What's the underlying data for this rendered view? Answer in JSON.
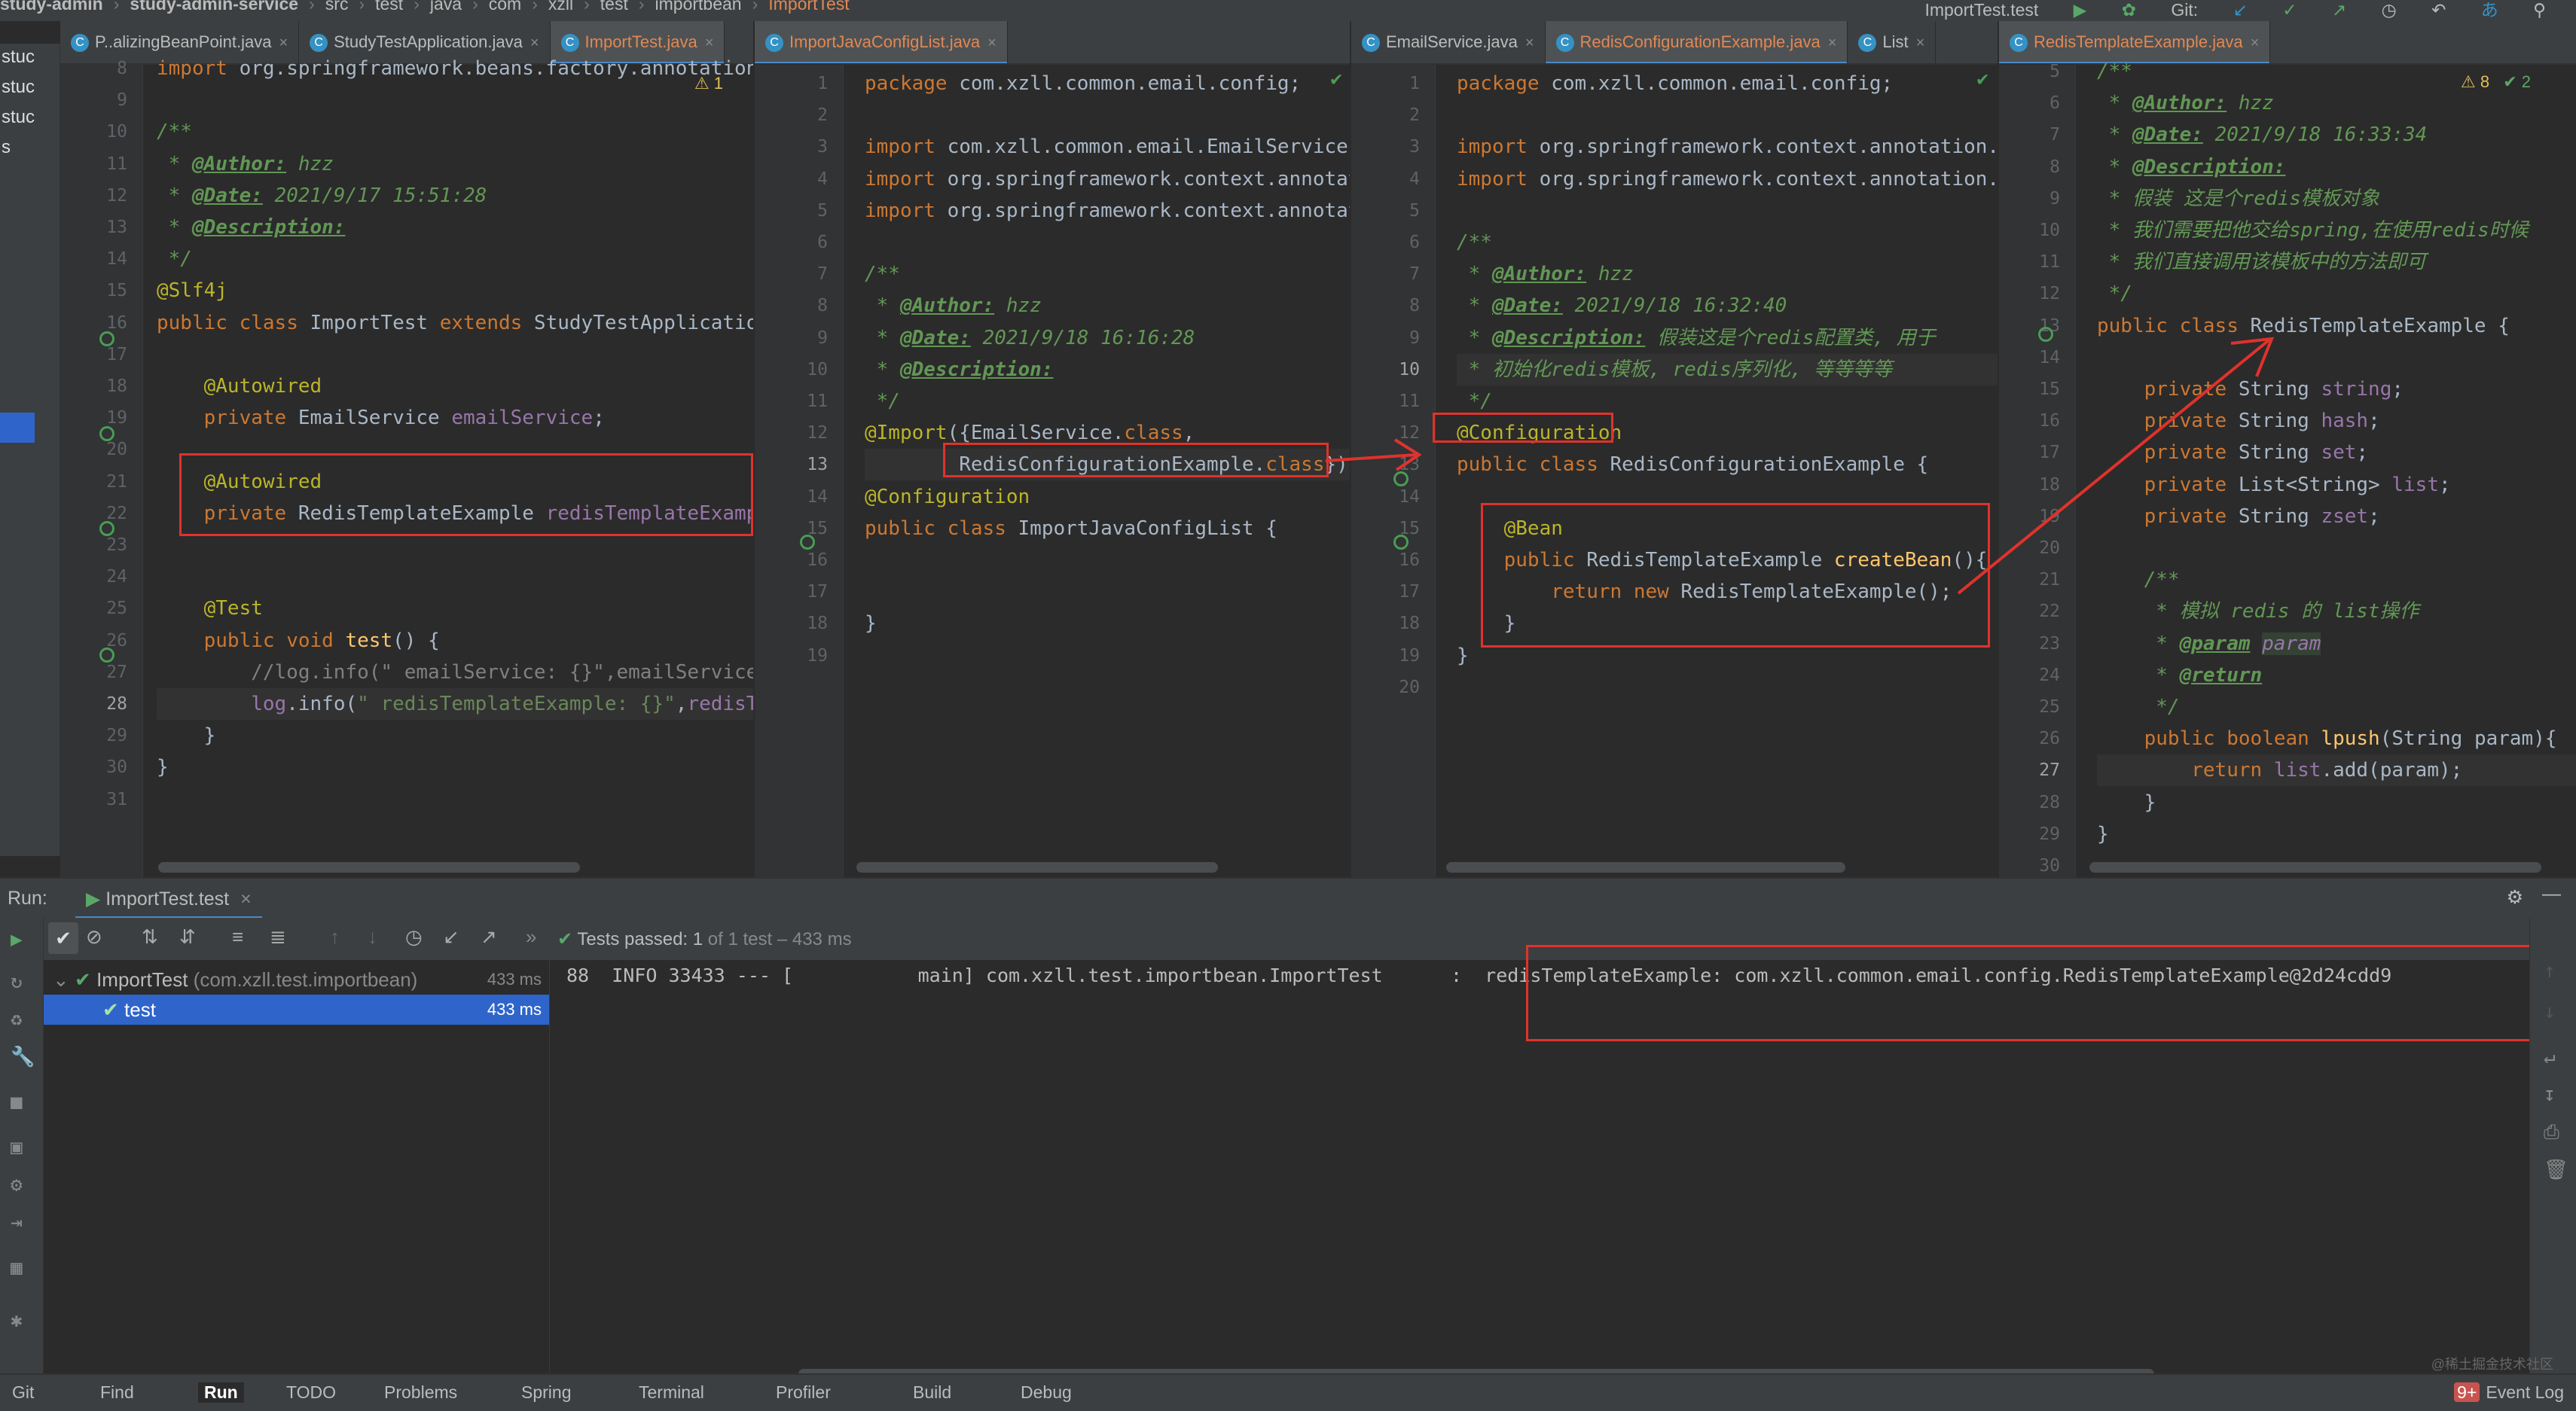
{
  "breadcrumb": [
    "study-admin",
    "study-admin-service",
    "src",
    "test",
    "java",
    "com",
    "xzll",
    "test",
    "importbean",
    "ImportTest"
  ],
  "topbar": {
    "run_config": "ImportTest.test",
    "git_label": "Git:"
  },
  "project_strip": [
    "stuc",
    "stuc",
    "stuc",
    "s"
  ],
  "pane1": {
    "tabs": [
      "P..alizingBeanPoint.java",
      "StudyTestApplication.java",
      "ImportTest.java"
    ],
    "warnings": "⚠ 1",
    "lines": [
      {
        "n": "8",
        "t": "import org.springframework.beans.factory.annotation.Autowired;"
      },
      {
        "n": "9",
        "t": ""
      },
      {
        "n": "10",
        "t": "/**"
      },
      {
        "n": "11",
        "t": " * @Author: hzz"
      },
      {
        "n": "12",
        "t": " * @Date: 2021/9/17 15:51:28"
      },
      {
        "n": "13",
        "t": " * @Description:"
      },
      {
        "n": "14",
        "t": " */"
      },
      {
        "n": "15",
        "t": "@Slf4j"
      },
      {
        "n": "16",
        "t": "public class ImportTest extends StudyTestApplication {"
      },
      {
        "n": "17",
        "t": ""
      },
      {
        "n": "18",
        "t": "    @Autowired"
      },
      {
        "n": "19",
        "t": "    private EmailService emailService;"
      },
      {
        "n": "20",
        "t": ""
      },
      {
        "n": "21",
        "t": "    @Autowired"
      },
      {
        "n": "22",
        "t": "    private RedisTemplateExample redisTemplateExample;"
      },
      {
        "n": "23",
        "t": ""
      },
      {
        "n": "24",
        "t": ""
      },
      {
        "n": "25",
        "t": "    @Test"
      },
      {
        "n": "26",
        "t": "    public void test() {"
      },
      {
        "n": "27",
        "t": "        //log.info(\" emailService: {}\",emailService);"
      },
      {
        "n": "28",
        "t": "        log.info(\" redisTemplateExample: {}\",redisTemplateExample);"
      },
      {
        "n": "29",
        "t": "    }"
      },
      {
        "n": "30",
        "t": "}"
      },
      {
        "n": "31",
        "t": ""
      }
    ]
  },
  "pane2": {
    "tabs": [
      "ImportJavaConfigList.java"
    ],
    "lines": [
      {
        "n": "1",
        "t": "package com.xzll.common.email.config;"
      },
      {
        "n": "2",
        "t": ""
      },
      {
        "n": "3",
        "t": "import com.xzll.common.email.EmailService;"
      },
      {
        "n": "4",
        "t": "import org.springframework.context.annotation.Configuration;"
      },
      {
        "n": "5",
        "t": "import org.springframework.context.annotation.Import;"
      },
      {
        "n": "6",
        "t": ""
      },
      {
        "n": "7",
        "t": "/**"
      },
      {
        "n": "8",
        "t": " * @Author: hzz"
      },
      {
        "n": "9",
        "t": " * @Date: 2021/9/18 16:16:28"
      },
      {
        "n": "10",
        "t": " * @Description:"
      },
      {
        "n": "11",
        "t": " */"
      },
      {
        "n": "12",
        "t": "@Import({EmailService.class,"
      },
      {
        "n": "13",
        "t": "        RedisConfigurationExample.class})"
      },
      {
        "n": "14",
        "t": "@Configuration"
      },
      {
        "n": "15",
        "t": "public class ImportJavaConfigList {"
      },
      {
        "n": "16",
        "t": ""
      },
      {
        "n": "17",
        "t": ""
      },
      {
        "n": "18",
        "t": "}"
      },
      {
        "n": "19",
        "t": ""
      }
    ]
  },
  "pane3": {
    "tabs": [
      "EmailService.java",
      "RedisConfigurationExample.java",
      "List"
    ],
    "lines": [
      {
        "n": "1",
        "t": "package com.xzll.common.email.config;"
      },
      {
        "n": "2",
        "t": ""
      },
      {
        "n": "3",
        "t": "import org.springframework.context.annotation.Bean;"
      },
      {
        "n": "4",
        "t": "import org.springframework.context.annotation.Configuration;"
      },
      {
        "n": "5",
        "t": ""
      },
      {
        "n": "6",
        "t": "/**"
      },
      {
        "n": "7",
        "t": " * @Author: hzz"
      },
      {
        "n": "8",
        "t": " * @Date: 2021/9/18 16:32:40"
      },
      {
        "n": "9",
        "t": " * @Description: 假装这是个redis配置类, 用于"
      },
      {
        "n": "10",
        "t": " * 初始化redis模板, redis序列化, 等等等等"
      },
      {
        "n": "11",
        "t": " */"
      },
      {
        "n": "12",
        "t": "@Configuration"
      },
      {
        "n": "13",
        "t": "public class RedisConfigurationExample {"
      },
      {
        "n": "14",
        "t": ""
      },
      {
        "n": "15",
        "t": "    @Bean"
      },
      {
        "n": "16",
        "t": "    public RedisTemplateExample createBean(){"
      },
      {
        "n": "17",
        "t": "        return new RedisTemplateExample();"
      },
      {
        "n": "18",
        "t": "    }"
      },
      {
        "n": "19",
        "t": "}"
      },
      {
        "n": "20",
        "t": ""
      }
    ]
  },
  "pane4": {
    "tabs": [
      "RedisTemplateExample.java"
    ],
    "warnings": "⚠ 8",
    "checks": "✔ 2",
    "lines": [
      {
        "n": "5",
        "t": "/**"
      },
      {
        "n": "6",
        "t": " * @Author: hzz"
      },
      {
        "n": "7",
        "t": " * @Date: 2021/9/18 16:33:34"
      },
      {
        "n": "8",
        "t": " * @Description:"
      },
      {
        "n": "9",
        "t": " * 假装 这是个redis模板对象"
      },
      {
        "n": "10",
        "t": " * 我们需要把他交给spring,在使用redis时候"
      },
      {
        "n": "11",
        "t": " * 我们直接调用该模板中的方法即可"
      },
      {
        "n": "12",
        "t": " */"
      },
      {
        "n": "13",
        "t": "public class RedisTemplateExample {"
      },
      {
        "n": "14",
        "t": ""
      },
      {
        "n": "15",
        "t": "    private String string;"
      },
      {
        "n": "16",
        "t": "    private String hash;"
      },
      {
        "n": "17",
        "t": "    private String set;"
      },
      {
        "n": "18",
        "t": "    private List<String> list;"
      },
      {
        "n": "19",
        "t": "    private String zset;"
      },
      {
        "n": "20",
        "t": ""
      },
      {
        "n": "21",
        "t": "    /**"
      },
      {
        "n": "22",
        "t": "     * 模拟 redis 的 list操作"
      },
      {
        "n": "23",
        "t": "     * @param param"
      },
      {
        "n": "24",
        "t": "     * @return"
      },
      {
        "n": "25",
        "t": "     */"
      },
      {
        "n": "26",
        "t": "    public boolean lpush(String param){"
      },
      {
        "n": "27",
        "t": "        return list.add(param);"
      },
      {
        "n": "28",
        "t": "    }"
      },
      {
        "n": "29",
        "t": "}"
      },
      {
        "n": "30",
        "t": ""
      }
    ]
  },
  "run": {
    "label": "Run:",
    "tab": "ImportTest.test",
    "status_prefix": "Tests passed:",
    "status_count": "1",
    "status_suffix": "of 1 test – 433 ms",
    "tree": [
      {
        "name": "ImportTest",
        "pkg": "(com.xzll.test.importbean)",
        "time": "433 ms"
      },
      {
        "name": "test",
        "time": "433 ms"
      }
    ],
    "console_line": "88  INFO 33433 --- [           main] com.xzll.test.importbean.ImportTest      :  redisTemplateExample: com.xzll.common.email.config.RedisTemplateExample@2d24cdd9"
  },
  "statusbar": [
    "Git",
    "Find",
    "Run",
    "TODO",
    "Problems",
    "Spring",
    "Terminal",
    "Profiler",
    "Build",
    "Debug"
  ],
  "event_log": "Event Log",
  "event_count": "9+",
  "watermark": "@稀土掘金技术社区",
  "colors": {
    "accent": "#e0322c",
    "selection": "#2f65ca",
    "pass": "#499c54"
  }
}
